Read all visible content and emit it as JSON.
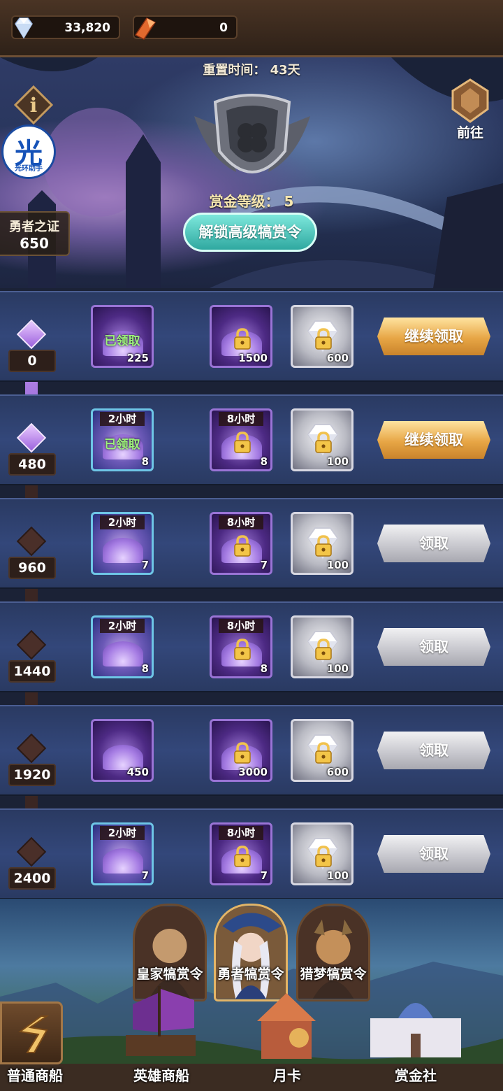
{
  "currency": {
    "diamonds": "33,820",
    "crystals": "0",
    "diamond_icon": "diamond-icon",
    "crystal_icon": "crystal-shard-icon"
  },
  "banner": {
    "reset_time": "重置时间：  43天",
    "info_label": "i",
    "helper_badge": {
      "char": "光",
      "text": "光环助手"
    },
    "proof": {
      "label": "勇者之证",
      "value": "650"
    },
    "goto_label": "前往",
    "bounty_level": "赏金等级：  5",
    "unlock_button": "解锁高级犒赏令"
  },
  "rows": [
    {
      "level": "0",
      "reached": true,
      "free": {
        "style": "purple",
        "qty": "225",
        "timer": "",
        "claimed": "已领取"
      },
      "premium": {
        "style": "purple",
        "qty": "1500",
        "timer": "",
        "locked": true
      },
      "elite": {
        "style": "silver",
        "qty": "600",
        "locked": true
      },
      "button": {
        "label": "继续领取",
        "style": "gold"
      }
    },
    {
      "level": "480",
      "reached": true,
      "free": {
        "style": "blue",
        "qty": "8",
        "timer": "2小时",
        "claimed": "已领取"
      },
      "premium": {
        "style": "purple",
        "qty": "8",
        "timer": "8小时",
        "locked": true
      },
      "elite": {
        "style": "silver",
        "qty": "100",
        "locked": true
      },
      "button": {
        "label": "继续领取",
        "style": "gold"
      }
    },
    {
      "level": "960",
      "reached": false,
      "free": {
        "style": "blue",
        "qty": "7",
        "timer": "2小时",
        "claimed": ""
      },
      "premium": {
        "style": "purple",
        "qty": "7",
        "timer": "8小时",
        "locked": true
      },
      "elite": {
        "style": "silver",
        "qty": "100",
        "locked": true
      },
      "button": {
        "label": "领取",
        "style": "gray"
      }
    },
    {
      "level": "1440",
      "reached": false,
      "free": {
        "style": "blue",
        "qty": "8",
        "timer": "2小时",
        "claimed": ""
      },
      "premium": {
        "style": "purple",
        "qty": "8",
        "timer": "8小时",
        "locked": true
      },
      "elite": {
        "style": "silver",
        "qty": "100",
        "locked": true
      },
      "button": {
        "label": "领取",
        "style": "gray"
      }
    },
    {
      "level": "1920",
      "reached": false,
      "free": {
        "style": "purple",
        "qty": "450",
        "timer": "",
        "claimed": ""
      },
      "premium": {
        "style": "purple",
        "qty": "3000",
        "timer": "",
        "locked": true
      },
      "elite": {
        "style": "silver",
        "qty": "600",
        "locked": true
      },
      "button": {
        "label": "领取",
        "style": "gray"
      }
    },
    {
      "level": "2400",
      "reached": false,
      "free": {
        "style": "blue",
        "qty": "7",
        "timer": "2小时",
        "claimed": ""
      },
      "premium": {
        "style": "purple",
        "qty": "7",
        "timer": "8小时",
        "locked": true
      },
      "elite": {
        "style": "silver",
        "qty": "100",
        "locked": true
      },
      "button": {
        "label": "领取",
        "style": "gray"
      }
    }
  ],
  "pass_tabs": [
    {
      "label": "皇家犒赏令",
      "selected": false
    },
    {
      "label": "勇者犒赏令",
      "selected": true
    },
    {
      "label": "猎梦犒赏令",
      "selected": false
    }
  ],
  "bottom_nav": [
    {
      "label": "普通商船"
    },
    {
      "label": "英雄商船"
    },
    {
      "label": "月卡"
    },
    {
      "label": "赏金社"
    }
  ],
  "colors": {
    "claim_gold": "#e7a645",
    "claim_gray": "#c9c9cf",
    "unlock_teal": "#2fa8a0",
    "claimed_green": "#9cf27a",
    "progress_purple": "#8d5cd1"
  }
}
